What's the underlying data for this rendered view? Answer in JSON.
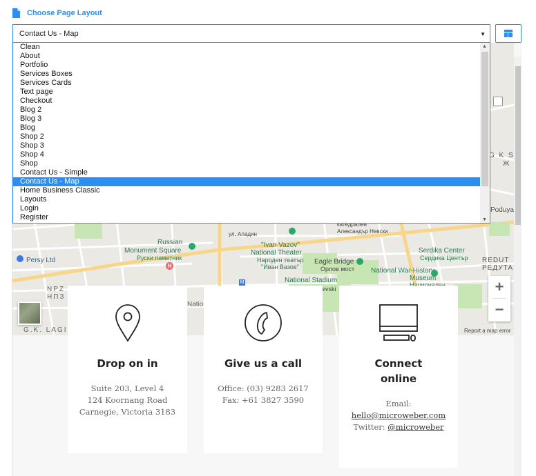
{
  "header": {
    "title": "Choose Page Layout",
    "icon": "document-icon"
  },
  "select": {
    "value": "Contact Us - Map"
  },
  "layout_button": {
    "icon": "layout-icon"
  },
  "dropdown": {
    "options": [
      "Clean",
      "About",
      "Portfolio",
      "Services Boxes",
      "Services Cards",
      "Text page",
      "Checkout",
      "Blog 2",
      "Blog 3",
      "Blog",
      "Shop 2",
      "Shop 3",
      "Shop 4",
      "Shop",
      "Contact Us - Simple",
      "Contact Us - Map",
      "Home Business Classic",
      "Layouts",
      "Login",
      "Register"
    ],
    "selected": "Contact Us - Map"
  },
  "map": {
    "labels": {
      "russian": "Russian",
      "monument_square": "Monument Square",
      "monument_cyr": "Руски паметник",
      "persy": "Persy Ltd",
      "ivan_vazov": "\"Ivan Vazov\"",
      "national_theater": "National Theater",
      "theater_cyr1": "Народен театър",
      "theater_cyr2": "\"Иван Вазов\"",
      "eagle_bridge": "Eagle Bridge",
      "orlov_most": "Орлов мост",
      "serdika": "Serdika Center",
      "serdika_cyr": "Сердика Център",
      "national_war": "National War-History",
      "museum": "Museum",
      "museum_cyr": "Национален",
      "national_stadium": "National Stadium",
      "redut": "REDUT",
      "reduta": "РЕДУТА",
      "npz": "NPZ",
      "npz_cyr": "НПЗ",
      "gk_lag": "G.K. LAGI",
      "natio": "Natio",
      "ul_aladin": "ул. Аладин",
      "katedral": "катедрален",
      "nevski": "Александър Невски",
      "gks": "G K S",
      "zh": "Ж",
      "poduya": "Poduya",
      "ul_evski": "evski",
      "hospital": "H",
      "report": "Report a map error"
    }
  },
  "cards": [
    {
      "title": "Drop on in",
      "lines": [
        "Suite 203, Level 4",
        "124 Koornang Road",
        "Carnegie, Victoria 3183"
      ],
      "icon": "map-pin-icon"
    },
    {
      "title": "Give us a call",
      "lines": [
        "Office: (03) 9283 2617",
        "Fax: +61 3827 3590"
      ],
      "icon": "phone-icon"
    },
    {
      "title_lines": [
        "Connect",
        "online"
      ],
      "email_label": "Email:",
      "email": "hello@microweber.com",
      "twitter_label": "Twitter: ",
      "twitter": "@microweber",
      "icon": "computer-icon"
    }
  ],
  "colors": {
    "accent": "#2b8ef0",
    "map_bg": "#ebe9e4",
    "park": "#c8e6b4"
  }
}
